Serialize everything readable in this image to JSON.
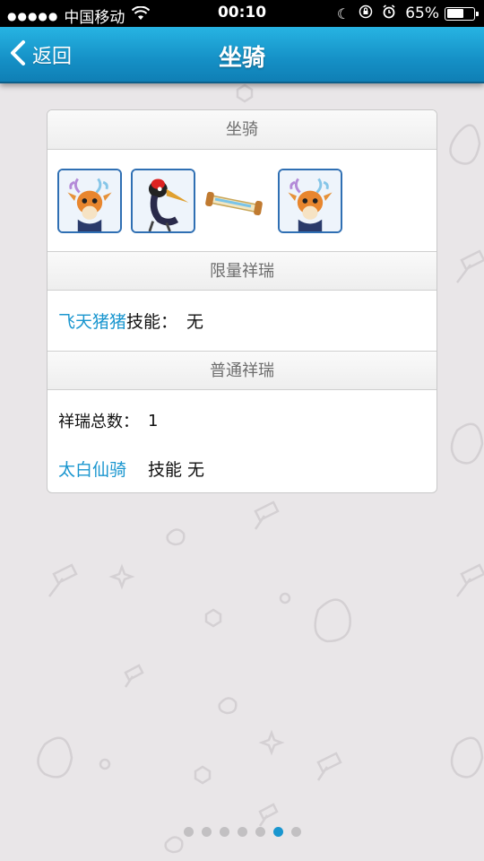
{
  "status_bar": {
    "signal": "●●●●●",
    "carrier": "中国移动",
    "time": "00:10",
    "battery": "65%",
    "battery_level": 0.65
  },
  "nav": {
    "back_label": "返回",
    "title": "坐骑"
  },
  "card": {
    "mounts_header": "坐骑",
    "mount_icons": [
      "deer-mount-icon",
      "crane-mount-icon",
      "scroll-item-icon",
      "deer-mount-icon"
    ],
    "limited_header": "限量祥瑞",
    "limited_mount_name": "飞天猪猪",
    "limited_skill_label": "技能：",
    "limited_skill_value": "无",
    "normal_header": "普通祥瑞",
    "normal_count_label": "祥瑞总数：",
    "normal_count_value": "1",
    "normal_mount_name": "太白仙骑",
    "normal_skill_text": "技能 无"
  },
  "pagination": {
    "total": 7,
    "active_index": 5
  },
  "colors": {
    "nav_blue": "#1590c6",
    "link_blue": "#1a96cf",
    "background": "#e9e6e8"
  }
}
